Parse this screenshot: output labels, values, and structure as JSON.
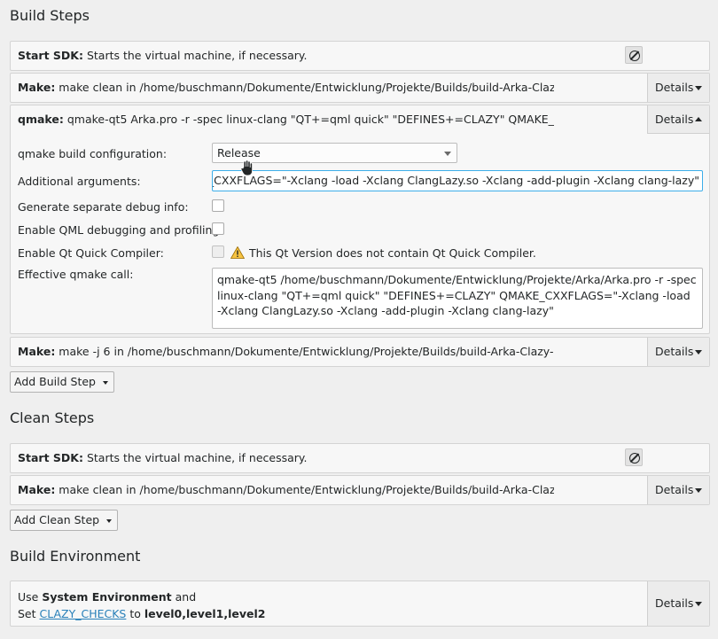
{
  "build_steps": {
    "title": "Build Steps",
    "start_sdk": {
      "name": "Start SDK:",
      "desc": " Starts the virtual machine, if necessary."
    },
    "make_clean": {
      "name": "Make:",
      "desc": " make clean in /home/buschmann/Dokumente/Entwicklung/Projekte/Builds/build-Arka-Clazy-Re",
      "details": "Details"
    },
    "qmake": {
      "name": "qmake:",
      "desc": " qmake-qt5 Arka.pro -r -spec linux-clang \"QT+=qml quick\" \"DEFINES+=CLAZY\" QMAKE_CXXFLA",
      "details": "Details",
      "build_config_label": "qmake build configuration:",
      "build_config_value": "Release",
      "additional_args_label": "Additional arguments:",
      "additional_args_value": "\"DEFINES+=CLAZY\" QMAKE_CXXFLAGS=\"-Xclang -load -Xclang ClangLazy.so -Xclang -add-plugin -Xclang clang-lazy\"",
      "separate_debug_label": "Generate separate debug info:",
      "qml_debug_label": "Enable QML debugging and profiling:",
      "quick_compiler_label": "Enable Qt Quick Compiler:",
      "quick_compiler_warning": "This Qt Version does not contain Qt Quick Compiler.",
      "effective_call_label": "Effective qmake call:",
      "effective_call_value": "qmake-qt5 /home/buschmann/Dokumente/Entwicklung/Projekte/Arka/Arka.pro -r -spec linux-clang \"QT+=qml quick\" \"DEFINES+=CLAZY\" QMAKE_CXXFLAGS=\"-Xclang -load -Xclang ClangLazy.so -Xclang -add-plugin -Xclang clang-lazy\""
    },
    "make_build": {
      "name": "Make:",
      "desc": " make -j 6 in /home/buschmann/Dokumente/Entwicklung/Projekte/Builds/build-Arka-Clazy-Rele",
      "details": "Details"
    },
    "add_button": "Add Build Step"
  },
  "clean_steps": {
    "title": "Clean Steps",
    "start_sdk": {
      "name": "Start SDK:",
      "desc": " Starts the virtual machine, if necessary."
    },
    "make_clean": {
      "name": "Make:",
      "desc": " make clean in /home/buschmann/Dokumente/Entwicklung/Projekte/Builds/build-Arka-Clazy-Re",
      "details": "Details"
    },
    "add_button": "Add Clean Step"
  },
  "build_env": {
    "title": "Build Environment",
    "use": "Use ",
    "system_env": "System Environment",
    "and": " and",
    "set": "Set ",
    "var_name": "CLAZY_CHECKS",
    "to": " to ",
    "var_value": "level0,level1,level2",
    "details": "Details"
  },
  "colors": {
    "accent": "#3daee9",
    "link": "#2980b9",
    "warning": "#f6c342"
  },
  "icons": [
    "disable-step-icon",
    "chevron-down-icon",
    "chevron-up-icon",
    "warning-icon",
    "hand-cursor-icon"
  ]
}
